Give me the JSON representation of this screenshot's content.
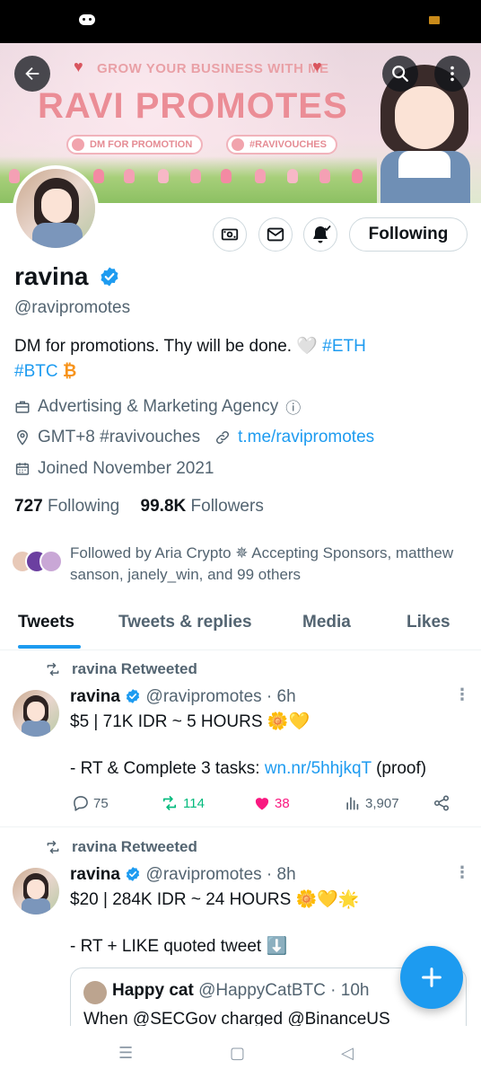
{
  "colors": {
    "accent": "#1d9bf0",
    "retweet_green": "#00ba7c",
    "like_pink": "#f91880",
    "muted": "#536471",
    "bitcoin_orange": "#f7931a"
  },
  "banner": {
    "tagline": "GROW YOUR BUSINESS WITH ME",
    "title": "RAVI PROMOTES",
    "pill_dm": "DM FOR PROMOTION",
    "pill_hash": "#RAVIVOUCHES"
  },
  "profile": {
    "name": "ravina",
    "handle": "@ravipromotes",
    "bio_text": "DM for promotions. Thy will be done. 🤍",
    "bio_tag_eth": "#ETH",
    "bio_tag_btc": "#BTC",
    "bio_btc_symbol": "₿",
    "category": "Advertising & Marketing Agency",
    "category_info": "ⓘ",
    "location": "GMT+8 #ravivouches",
    "link": "t.me/ravipromotes",
    "joined": "Joined November 2021",
    "following_count": "727",
    "following_label": "Following",
    "followers_count": "99.8K",
    "followers_label": "Followers",
    "followed_by": "Followed by Aria Crypto ✵ Accepting Sponsors, matthew sanson, janely_win, and 99 others",
    "follow_state": "Following"
  },
  "tabs": [
    {
      "label": "Tweets"
    },
    {
      "label": "Tweets & replies"
    },
    {
      "label": "Media"
    },
    {
      "label": "Likes"
    }
  ],
  "tweets": [
    {
      "retweeted_by": "ravina Retweeted",
      "name": "ravina",
      "handle_time": "@ravipromotes · 6h",
      "line1": "$5 | 71K IDR ~ 5 HOURS 🌼💛",
      "line2_prefix": "- RT & Complete 3 tasks: ",
      "line2_link": "wn.nr/5hhjkqT",
      "line2_suffix": " (proof)",
      "replies": "75",
      "retweets": "114",
      "likes": "38",
      "views": "3,907"
    },
    {
      "retweeted_by": "ravina Retweeted",
      "name": "ravina",
      "handle_time": "@ravipromotes · 8h",
      "line1": "$20 | 284K IDR ~ 24 HOURS 🌼💛🌟",
      "line2": "- RT + LIKE quoted tweet ⬇️",
      "quote_name": "Happy cat",
      "quote_handle_time": "@HappyCatBTC · 10h",
      "quote_text": "When @SECGov charged @BinanceUS"
    }
  ],
  "navbar": {
    "menu": "☰",
    "home": "▢",
    "back": "◁"
  }
}
